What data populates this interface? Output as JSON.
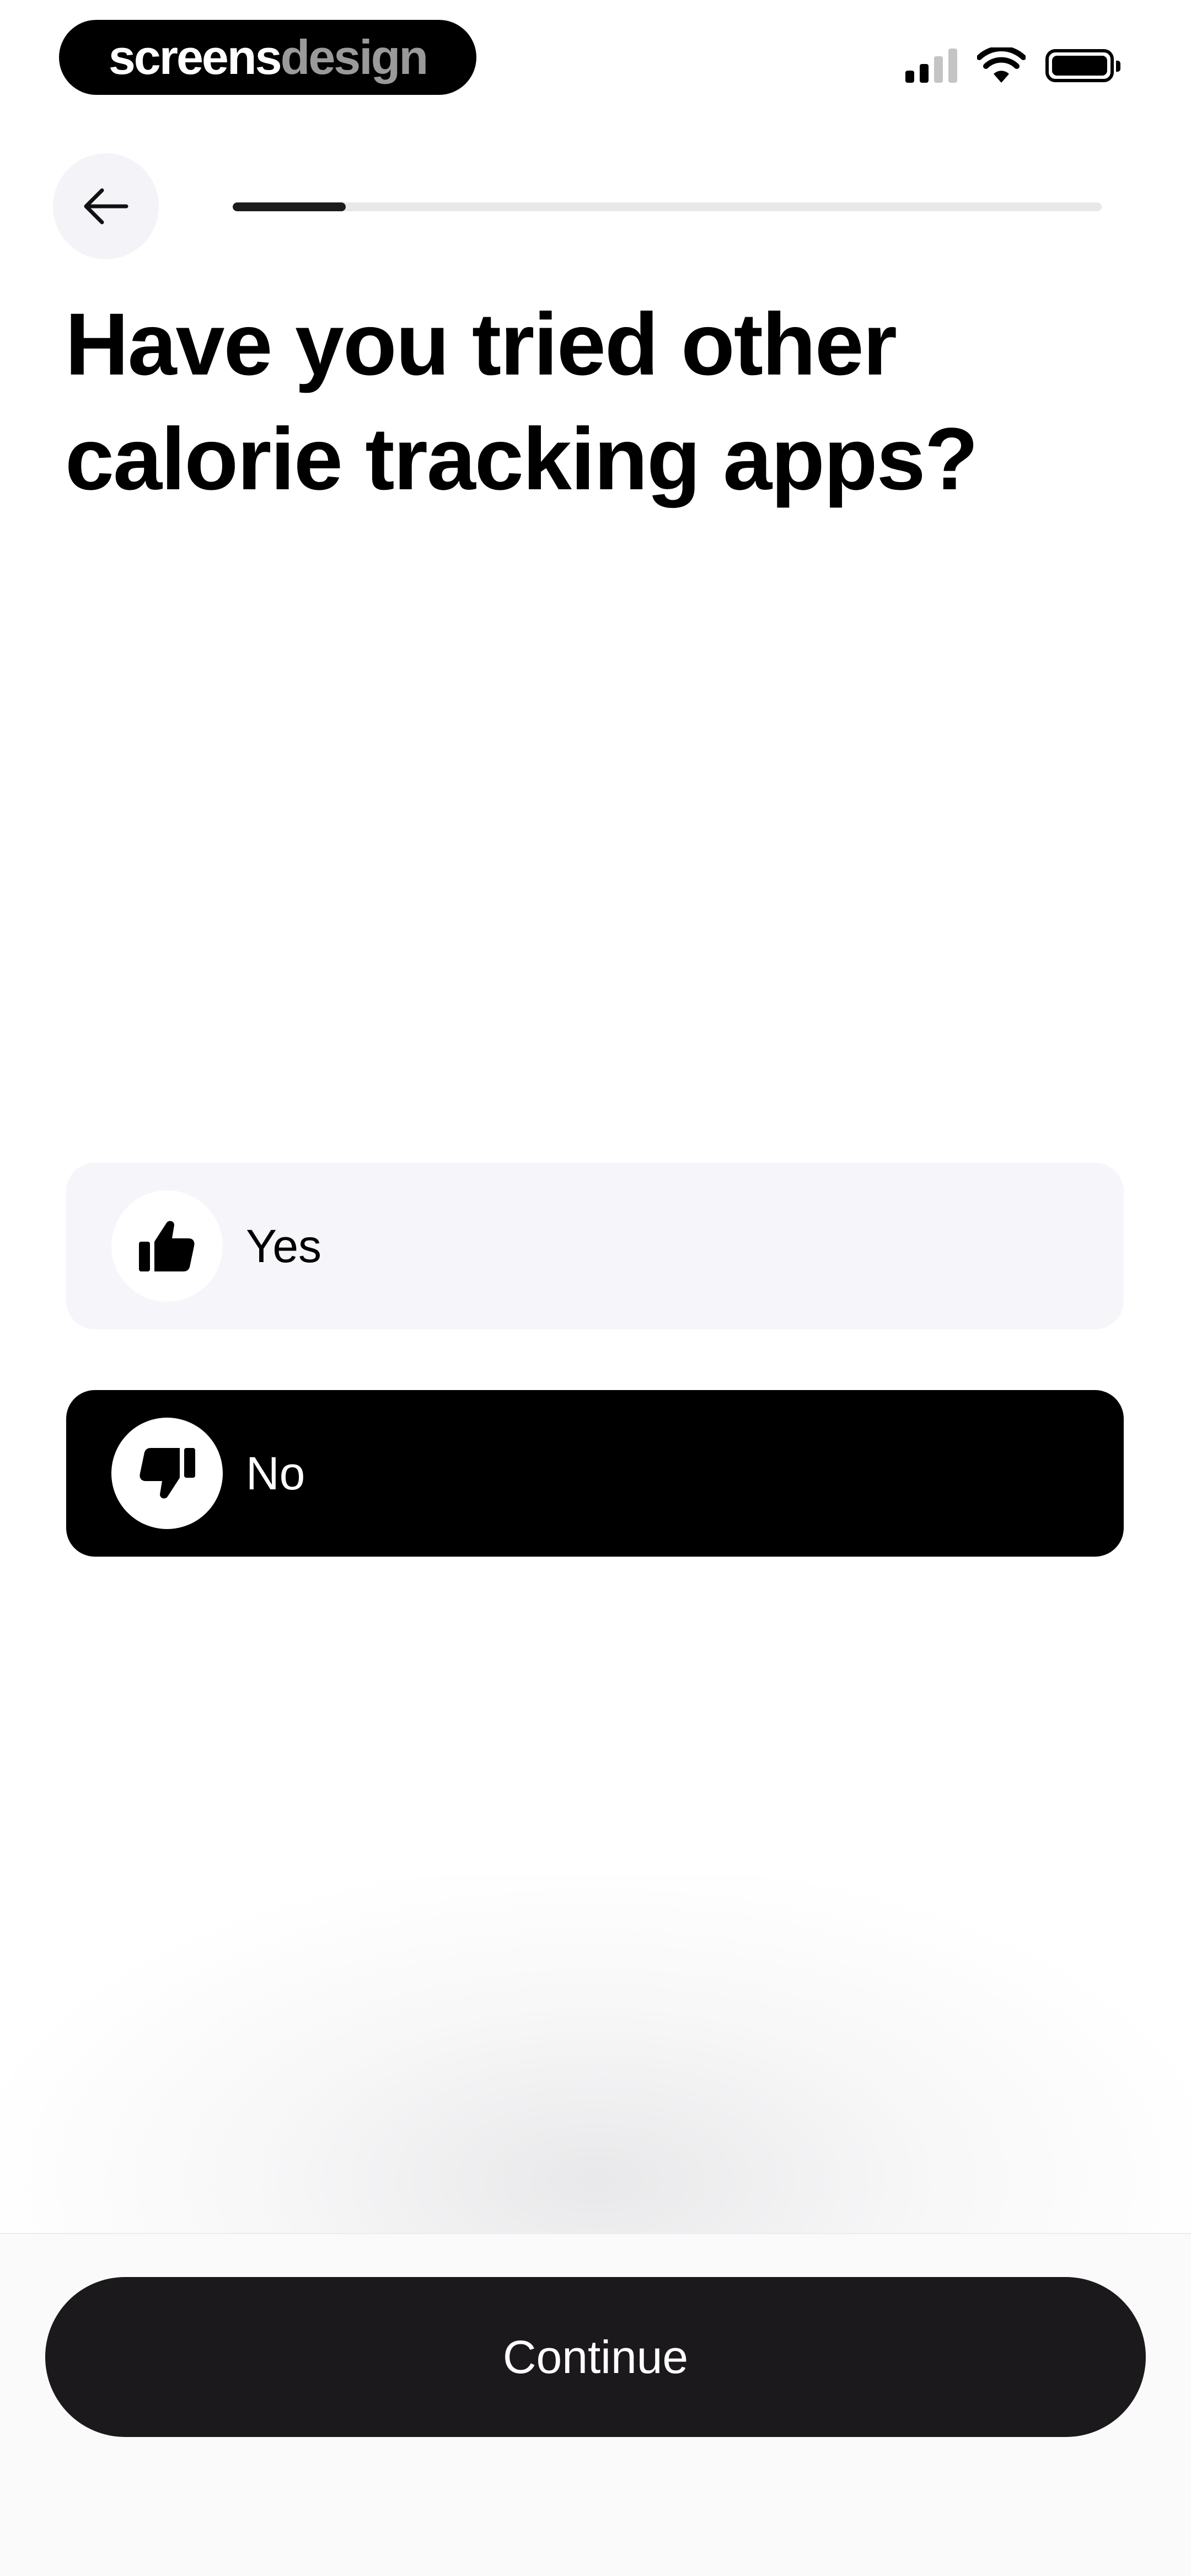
{
  "status_bar": {
    "brand_part1": "screens",
    "brand_part2": "design",
    "icons": [
      "cellular-signal-icon",
      "wifi-icon",
      "battery-icon"
    ]
  },
  "nav": {
    "back_icon": "arrow-left-icon",
    "progress": 0.13
  },
  "question": {
    "title": "Have you tried other calorie tracking apps?"
  },
  "options": [
    {
      "label": "Yes",
      "icon": "thumbs-up-icon",
      "selected": false
    },
    {
      "label": "No",
      "icon": "thumbs-down-icon",
      "selected": true
    }
  ],
  "footer": {
    "continue_label": "Continue"
  },
  "colors": {
    "selected_bg": "#000000",
    "unselected_bg": "#f5f5fa",
    "button_bg": "#1b191c",
    "progress_fill": "#1c1c1e",
    "progress_track": "#e8e8ea"
  }
}
